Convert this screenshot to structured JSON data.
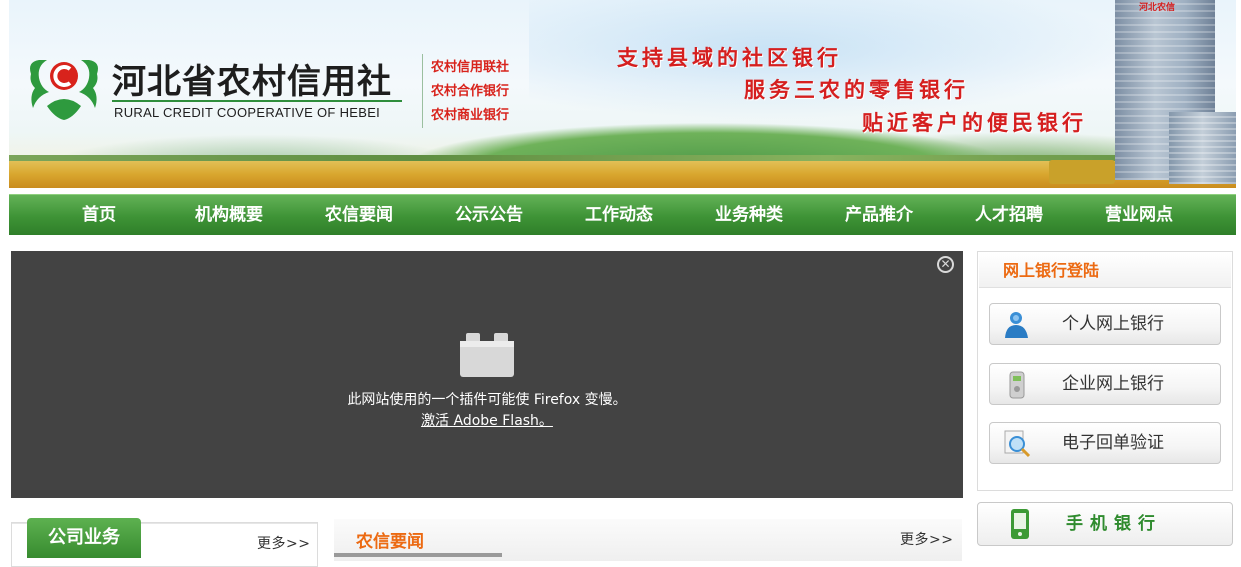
{
  "header": {
    "logo_cn": "河北省农村信用社",
    "logo_en": "RURAL CREDIT COOPERATIVE OF HEBEI",
    "tags": [
      "农村信用联社",
      "农村合作银行",
      "农村商业银行"
    ],
    "slogans": [
      "支持县域的社区银行",
      "服务三农的零售银行",
      "贴近客户的便民银行"
    ],
    "building_sign": "河北农信"
  },
  "nav": {
    "items": [
      "首页",
      "机构概要",
      "农信要闻",
      "公示公告",
      "工作动态",
      "业务种类",
      "产品推介",
      "人才招聘",
      "营业网点"
    ]
  },
  "flash": {
    "message": "此网站使用的一个插件可能使 Firefox 变慢。",
    "link": "激活 Adobe Flash。",
    "close_icon": "close-icon"
  },
  "login": {
    "title": "网上银行登陆",
    "buttons": [
      "个人网上银行",
      "企业网上银行",
      "电子回单验证"
    ]
  },
  "mobile_bank": {
    "label": "手机银行"
  },
  "company_business": {
    "tab": "公司业务",
    "more": "更多>>"
  },
  "news": {
    "title": "农信要闻",
    "more": "更多>>"
  },
  "colors": {
    "nav_green": "#3e9336",
    "accent_orange": "#ec6a12",
    "slogan_red": "#d51f1f",
    "flash_bg": "#434343"
  }
}
